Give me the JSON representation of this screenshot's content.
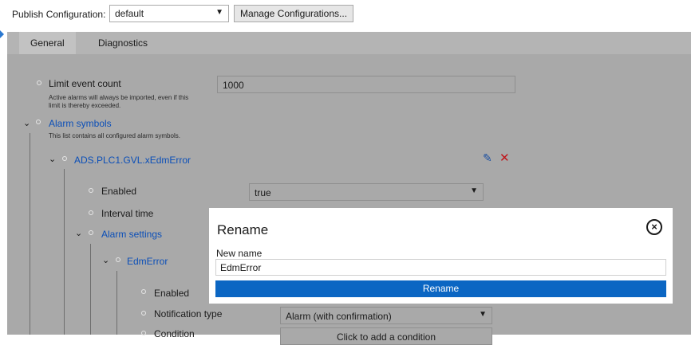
{
  "publish": {
    "label": "Publish Configuration:",
    "selected": "default",
    "manage_label": "Manage Configurations..."
  },
  "tabs": [
    {
      "label": "General"
    },
    {
      "label": "Diagnostics"
    }
  ],
  "settings": {
    "limit_label": "Limit event count",
    "limit_hint_1": "Active alarms will always be imported, even if this",
    "limit_hint_2": "limit is thereby exceeded.",
    "limit_value": "1000",
    "alarm_symbols_label": "Alarm symbols",
    "alarm_symbols_hint": "This list contains all configured alarm symbols.",
    "symbol_name": "ADS.PLC1.GVL.xEdmError",
    "enabled_label": "Enabled",
    "enabled_value": "true",
    "interval_label": "Interval time",
    "alarm_settings_label": "Alarm settings",
    "edm_label": "EdmError",
    "enabled2_label": "Enabled",
    "notification_label": "Notification type",
    "notification_value": "Alarm (with confirmation)",
    "condition_label": "Condition",
    "condition_value": "Click to add a condition"
  },
  "modal": {
    "title": "Rename",
    "field_label": "New name",
    "field_value": "EdmError",
    "button_label": "Rename"
  }
}
